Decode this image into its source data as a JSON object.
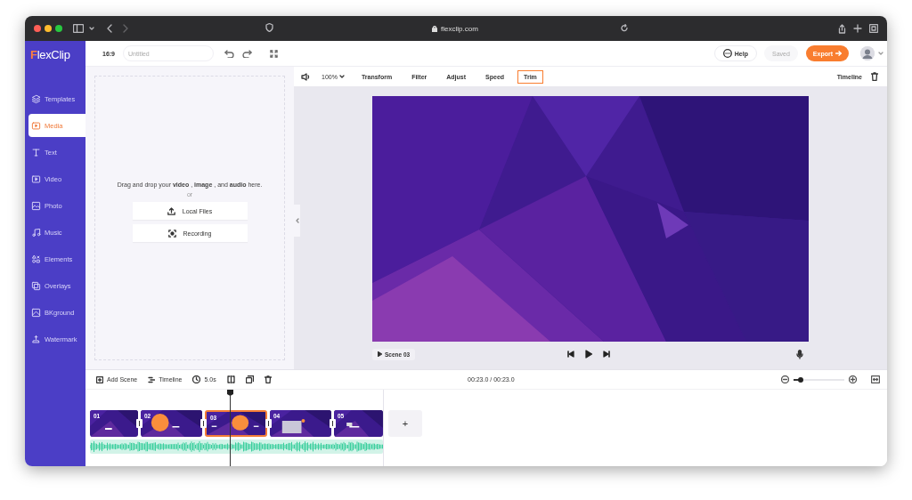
{
  "browser": {
    "url": "flexclip.com"
  },
  "logo": "FlexClip",
  "sidebar": {
    "items": [
      {
        "label": "Templates",
        "selected": false
      },
      {
        "label": "Media",
        "selected": true
      },
      {
        "label": "Text",
        "selected": false
      },
      {
        "label": "Video",
        "selected": false
      },
      {
        "label": "Photo",
        "selected": false
      },
      {
        "label": "Music",
        "selected": false
      },
      {
        "label": "Elements",
        "selected": false
      },
      {
        "label": "Overlays",
        "selected": false
      },
      {
        "label": "BKground",
        "selected": false
      },
      {
        "label": "Watermark",
        "selected": false
      }
    ]
  },
  "header": {
    "aspect": "16:9",
    "title_field": {
      "placeholder": "Untitled"
    },
    "help": "Help",
    "saved": {
      "label": "Saved",
      "disabled": true
    },
    "export": "Export"
  },
  "edit_toolbar": {
    "zoom": "100%",
    "tabs": [
      {
        "label": "Transform",
        "selected": false
      },
      {
        "label": "Filter",
        "selected": false
      },
      {
        "label": "Adjust",
        "selected": false
      },
      {
        "label": "Speed",
        "selected": false
      },
      {
        "label": "Trim",
        "selected": true
      }
    ],
    "timeline": "Timeline"
  },
  "upload": {
    "prompt": "Drag and drop your **video** , **image** , and **audio** here.",
    "or": "or",
    "buttons": [
      {
        "label": "Local Files",
        "kind": "upload"
      },
      {
        "label": "Recording",
        "kind": "record"
      }
    ]
  },
  "player": {
    "scene_label": "Scene 03"
  },
  "timeline_toolbar": {
    "add_scene": "Add Scene",
    "timeline": "Timeline",
    "duration": "5.0s",
    "time": "00:23.0 / 00:23.0",
    "zoom": {
      "level": 0.14
    }
  },
  "scenes": [
    {
      "number": "01",
      "selected": false
    },
    {
      "number": "02",
      "selected": false
    },
    {
      "number": "03",
      "selected": true
    },
    {
      "number": "04",
      "selected": false
    },
    {
      "number": "05",
      "selected": false
    }
  ],
  "add_scene_button": "+"
}
